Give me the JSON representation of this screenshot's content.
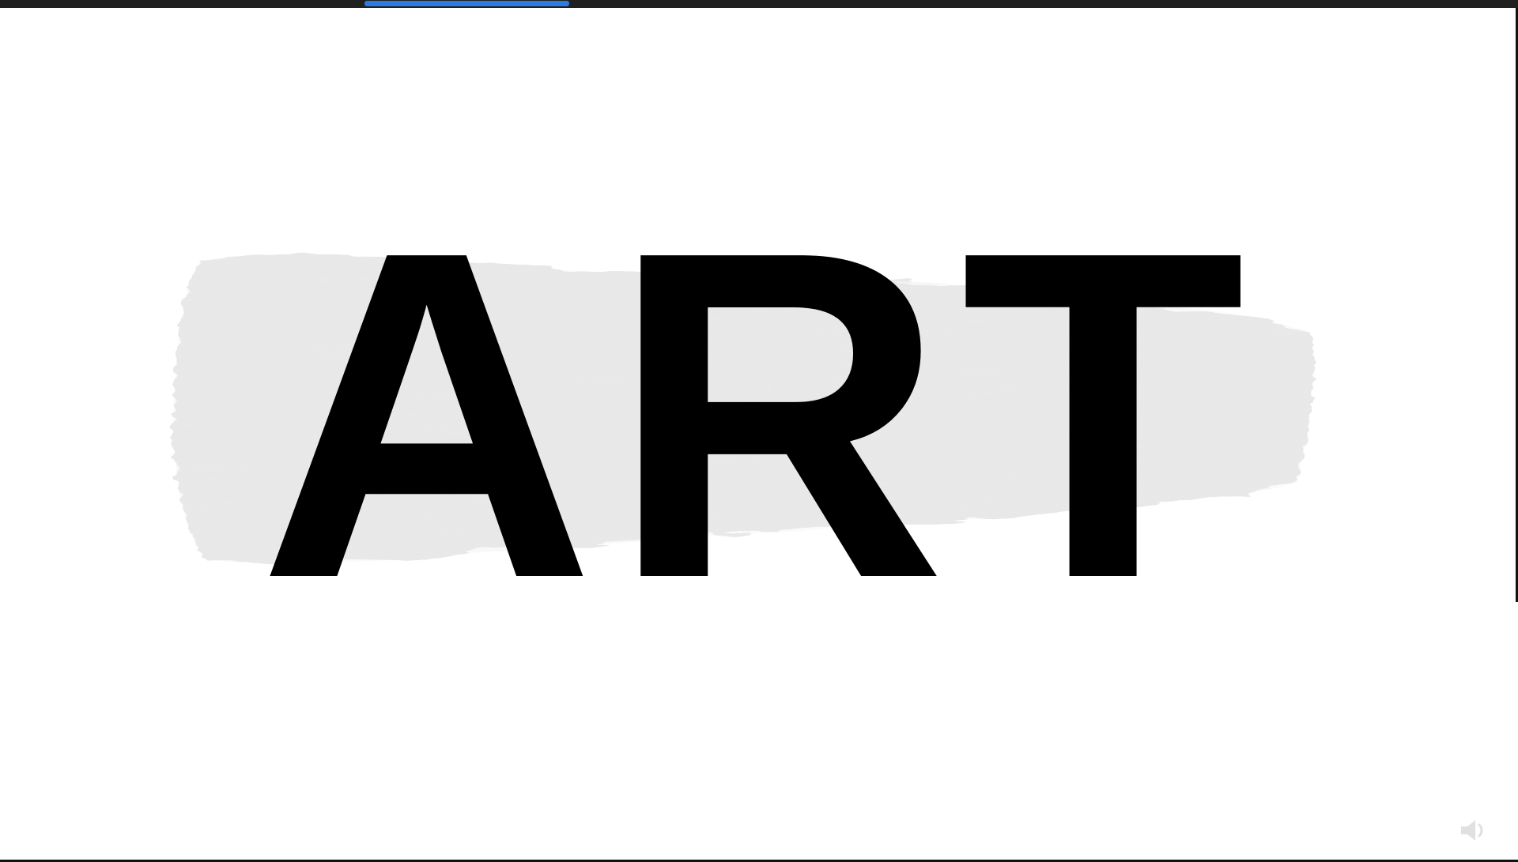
{
  "screen": {
    "headline_text": "ART",
    "colors": {
      "background": "#ffffff",
      "top_bar": "#202020",
      "progress": "#2d7bdf",
      "text": "#000000",
      "brush": "#e8e8e8",
      "brush_shadow": "#cfcfcf"
    }
  },
  "progress": {
    "start_fraction": 0.24,
    "end_fraction": 0.375
  },
  "icons": {
    "corner": "volume-icon"
  }
}
